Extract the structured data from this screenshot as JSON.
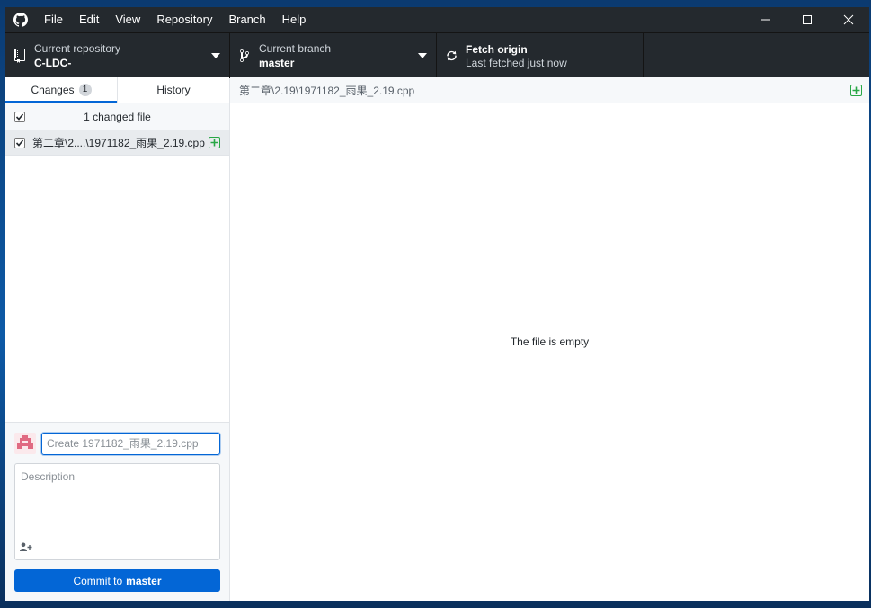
{
  "menu": {
    "items": [
      "File",
      "Edit",
      "View",
      "Repository",
      "Branch",
      "Help"
    ]
  },
  "toolbar": {
    "repository": {
      "label": "Current repository",
      "value": "C-LDC-"
    },
    "branch": {
      "label": "Current branch",
      "value": "master"
    },
    "fetch": {
      "title": "Fetch origin",
      "subtitle": "Last fetched just now"
    }
  },
  "sidebar": {
    "tabs": [
      {
        "label": "Changes",
        "count": "1"
      },
      {
        "label": "History"
      }
    ],
    "changed_header": "1 changed file",
    "files": [
      {
        "name": "第二章\\2....\\1971182_雨果_2.19.cpp",
        "status": "added"
      }
    ]
  },
  "commit": {
    "summary_placeholder": "Create 1971182_雨果_2.19.cpp",
    "description_placeholder": "Description",
    "button_prefix": "Commit to",
    "button_branch": "master"
  },
  "diff": {
    "path": "第二章\\2.19\\1971182_雨果_2.19.cpp",
    "empty_message": "The file is empty"
  },
  "colors": {
    "accent": "#0366d6",
    "toolbar_bg": "#24292e",
    "added": "#28a745"
  }
}
